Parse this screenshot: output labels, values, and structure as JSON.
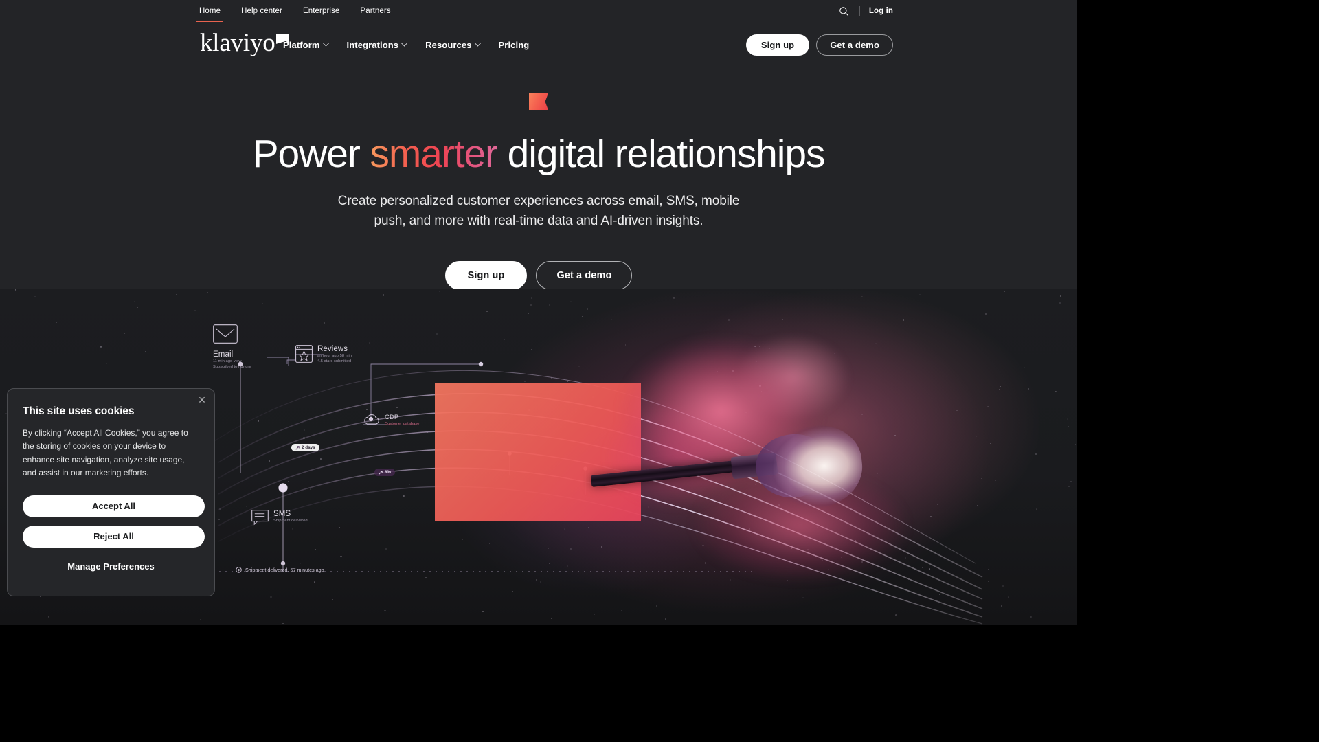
{
  "meta": {
    "background": "#232427",
    "accent_coral": "#e8634f",
    "brand": "klaviyo"
  },
  "utility_bar": {
    "links": [
      {
        "label": "Home",
        "active": true
      },
      {
        "label": "Help center",
        "active": false
      },
      {
        "label": "Enterprise",
        "active": false
      },
      {
        "label": "Partners",
        "active": false
      }
    ],
    "search_icon": "search-icon",
    "login_label": "Log in"
  },
  "header": {
    "logo_text": "klaviyo",
    "logo_mark": "flag-icon",
    "nav": [
      {
        "label": "Platform",
        "has_dropdown": true
      },
      {
        "label": "Integrations",
        "has_dropdown": true
      },
      {
        "label": "Resources",
        "has_dropdown": true
      },
      {
        "label": "Pricing",
        "has_dropdown": false
      }
    ],
    "cta": {
      "signup_label": "Sign up",
      "demo_label": "Get a demo"
    }
  },
  "hero": {
    "badge_icon": "flag-icon",
    "heading_part1": "Power ",
    "heading_highlight": "smarter",
    "heading_part2": " digital relationships",
    "subheading": "Create personalized customer experiences across email, SMS, mobile push, and more with real-time data and AI-driven insights.",
    "cta_primary": "Sign up",
    "cta_secondary": "Get a demo"
  },
  "hero_art": {
    "nodes": [
      {
        "id": "email",
        "icon": "envelope-icon",
        "title": "Email",
        "sub_line1": "11 min ago view",
        "sub_line2": "Subscribed to nurture"
      },
      {
        "id": "reviews",
        "icon": "review-star-icon",
        "title": "Reviews",
        "sub_line1": "an hour ago 58 min",
        "sub_line2": "4.5 stars submitted"
      },
      {
        "id": "sms",
        "icon": "message-icon",
        "title": "SMS",
        "sub_line1": "Shipment delivered",
        "sub_line2": ""
      },
      {
        "id": "cdp",
        "icon": "cloud-icon",
        "title": "CDP",
        "sub_line1": "Customer database",
        "sub_line2": ""
      }
    ],
    "pills": [
      {
        "id": "delay",
        "icon": "arrow-up-right-icon",
        "label": "2 days"
      },
      {
        "id": "lift",
        "icon": "arrow-up-right-icon",
        "label": "8%"
      }
    ],
    "footnote": {
      "icon": "target-icon",
      "label": "Shipment delivered, 57 minutes ago"
    }
  },
  "cookie_banner": {
    "title": "This site uses cookies",
    "body": "By clicking “Accept All Cookies,” you agree to the storing of cookies on your device to enhance site navigation, analyze site usage, and assist in our marketing efforts.",
    "accept_label": "Accept All",
    "reject_label": "Reject All",
    "manage_label": "Manage Preferences",
    "close_icon": "close-icon"
  }
}
